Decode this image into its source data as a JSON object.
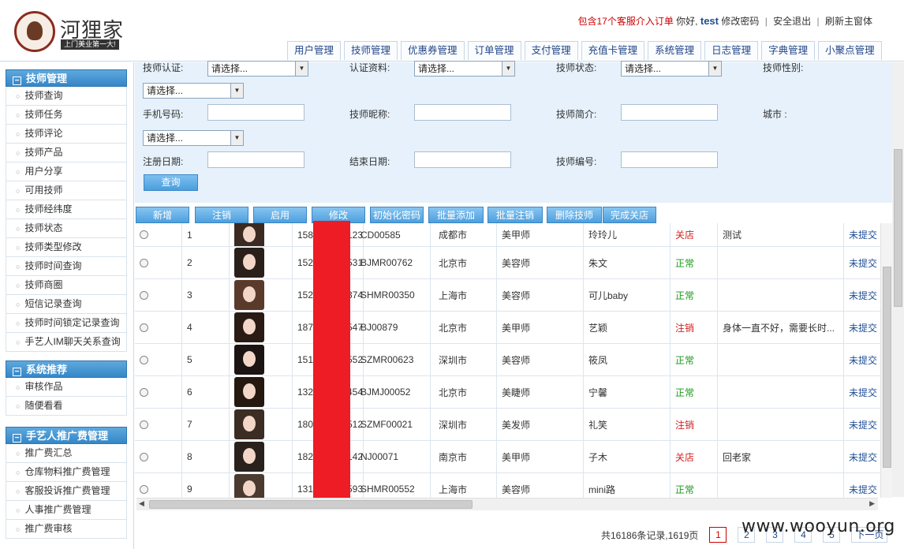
{
  "brand": {
    "name": "河狸家",
    "slogan": "上门美业第一大!"
  },
  "topbar": {
    "alert": "包含17个客服介入订单",
    "greeting": "你好,",
    "username": "test",
    "change_password": "修改密码",
    "logout": "安全退出",
    "refresh": "刷新主窗体"
  },
  "nav": [
    "用户管理",
    "技师管理",
    "优惠券管理",
    "订单管理",
    "支付管理",
    "充值卡管理",
    "系统管理",
    "日志管理",
    "字典管理",
    "小聚点管理"
  ],
  "sidebar": [
    {
      "title": "技师管理",
      "items": [
        "技师查询",
        "技师任务",
        "技师评论",
        "技师产品",
        "用户分享",
        "可用技师",
        "技师经纬度",
        "技师状态",
        "技师类型修改",
        "技师时间查询",
        "技师商圈",
        "短信记录查询",
        "技师时间锁定记录查询",
        "手艺人IM聊天关系查询"
      ]
    },
    {
      "title": "系统推荐",
      "items": [
        "审核作品",
        "随便看看"
      ]
    },
    {
      "title": "手艺人推广费管理",
      "items": [
        "推广费汇总",
        "仓库物料推广费管理",
        "客服投诉推广费管理",
        "人事推广费管理",
        "推广费审核"
      ]
    }
  ],
  "search": {
    "cert_label": "技师认证:",
    "cert_value": "请选择...",
    "cert_info_label": "认证资料:",
    "cert_info_value": "请选择...",
    "status_label": "技师状态:",
    "status_value": "请选择...",
    "gender_label": "技师性别:",
    "gender_value": "请选择...",
    "phone_label": "手机号码:",
    "nickname_label": "技师昵称:",
    "intro_label": "技师简介:",
    "city_label": "城市 :",
    "city_value": "请选择...",
    "reg_date_label": "注册日期:",
    "end_date_label": "结束日期:",
    "tech_no_label": "技师编号:",
    "query_button": "查询"
  },
  "actions": [
    "新增",
    "注销",
    "启用",
    "修改",
    "初始化密码",
    "批量添加",
    "批量注销",
    "删除技师",
    "完成关店"
  ],
  "colors": {
    "active": "#1a9a1a",
    "inactive": "#d22222",
    "link": "#1f4e96",
    "header_blue": "#3487c8",
    "panel": "#e6f1fb"
  },
  "rows": [
    {
      "no": "1",
      "phone_a": "158",
      "phone_b": "123",
      "code": "CD00585",
      "city": "成都市",
      "type": "美甲师",
      "name": "玲玲儿",
      "status": "关店",
      "status_color": "#d22222",
      "note": "测试",
      "submit": "未提交"
    },
    {
      "no": "2",
      "phone_a": "152",
      "phone_b": "531",
      "code": "BJMR00762",
      "city": "北京市",
      "type": "美容师",
      "name": "朱文",
      "status": "正常",
      "status_color": "#1a9a1a",
      "note": "",
      "submit": "未提交"
    },
    {
      "no": "3",
      "phone_a": "152",
      "phone_b": "374",
      "code": "SHMR00350",
      "city": "上海市",
      "type": "美容师",
      "name": "可儿baby",
      "status": "正常",
      "status_color": "#1a9a1a",
      "note": "",
      "submit": "未提交"
    },
    {
      "no": "4",
      "phone_a": "187",
      "phone_b": "547",
      "code": "BJ00879",
      "city": "北京市",
      "type": "美甲师",
      "name": "艺颖",
      "status": "注销",
      "status_color": "#d22222",
      "note": "身体一直不好，需要长时...",
      "submit": "未提交"
    },
    {
      "no": "5",
      "phone_a": "151",
      "phone_b": "552",
      "code": "SZMR00623",
      "city": "深圳市",
      "type": "美容师",
      "name": "筱凤",
      "status": "正常",
      "status_color": "#1a9a1a",
      "note": "",
      "submit": "未提交"
    },
    {
      "no": "6",
      "phone_a": "132",
      "phone_b": "454",
      "code": "BJMJ00052",
      "city": "北京市",
      "type": "美睫师",
      "name": "宁馨",
      "status": "正常",
      "status_color": "#1a9a1a",
      "note": "",
      "submit": "未提交"
    },
    {
      "no": "7",
      "phone_a": "180",
      "phone_b": "512",
      "code": "SZMF00021",
      "city": "深圳市",
      "type": "美发师",
      "name": "礼笑",
      "status": "注销",
      "status_color": "#d22222",
      "note": "",
      "submit": "未提交"
    },
    {
      "no": "8",
      "phone_a": "182",
      "phone_b": "142",
      "code": "NJ00071",
      "city": "南京市",
      "type": "美甲师",
      "name": "子木",
      "status": "关店",
      "status_color": "#d22222",
      "note": "回老家",
      "submit": "未提交"
    },
    {
      "no": "9",
      "phone_a": "131",
      "phone_b": "593",
      "code": "SHMR00552",
      "city": "上海市",
      "type": "美容师",
      "name": "mini路",
      "status": "正常",
      "status_color": "#1a9a1a",
      "note": "",
      "submit": "未提交"
    }
  ],
  "pager": {
    "summary": "共16186条记录,1619页",
    "pages": [
      "1",
      "2",
      "3",
      "4",
      "5"
    ],
    "next": "下一页"
  },
  "watermark": "www.wooyun.org"
}
